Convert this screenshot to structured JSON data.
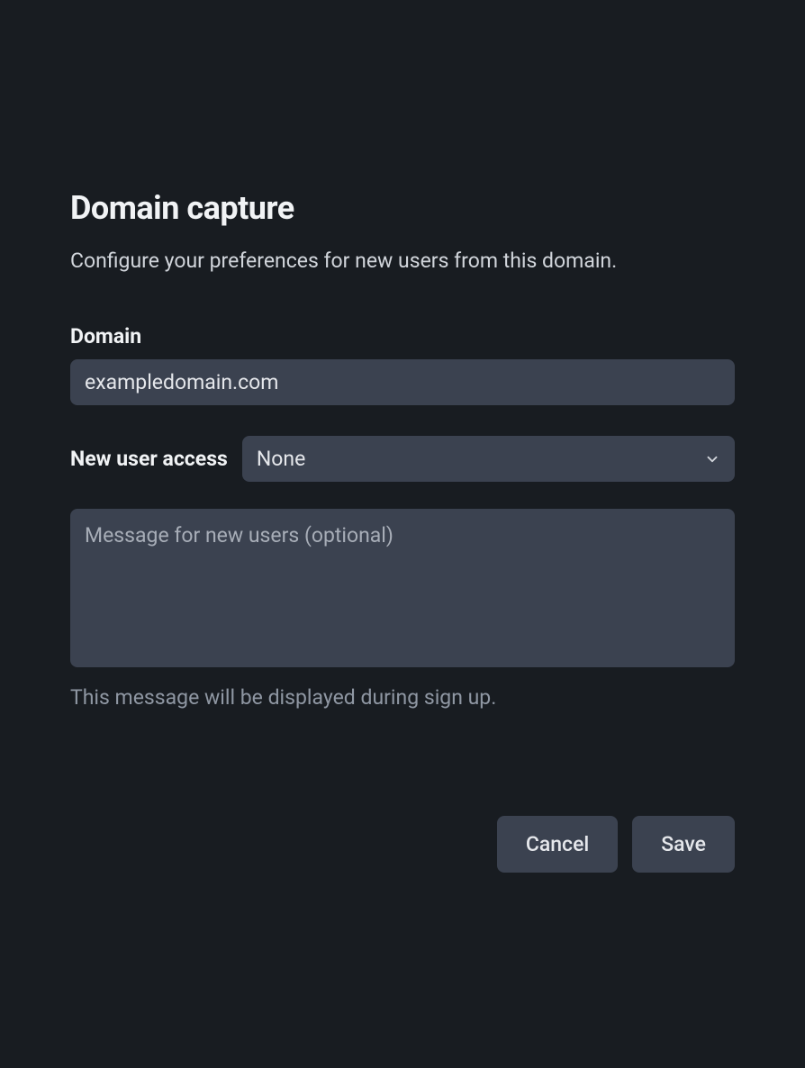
{
  "header": {
    "title": "Domain capture",
    "subtitle": "Configure your preferences for new users from this domain."
  },
  "form": {
    "domain": {
      "label": "Domain",
      "value": "exampledomain.com"
    },
    "access": {
      "label": "New user access",
      "selected": "None"
    },
    "message": {
      "placeholder": "Message for new users (optional)",
      "value": "",
      "helper": "This message will be displayed during sign up."
    }
  },
  "buttons": {
    "cancel": "Cancel",
    "save": "Save"
  }
}
